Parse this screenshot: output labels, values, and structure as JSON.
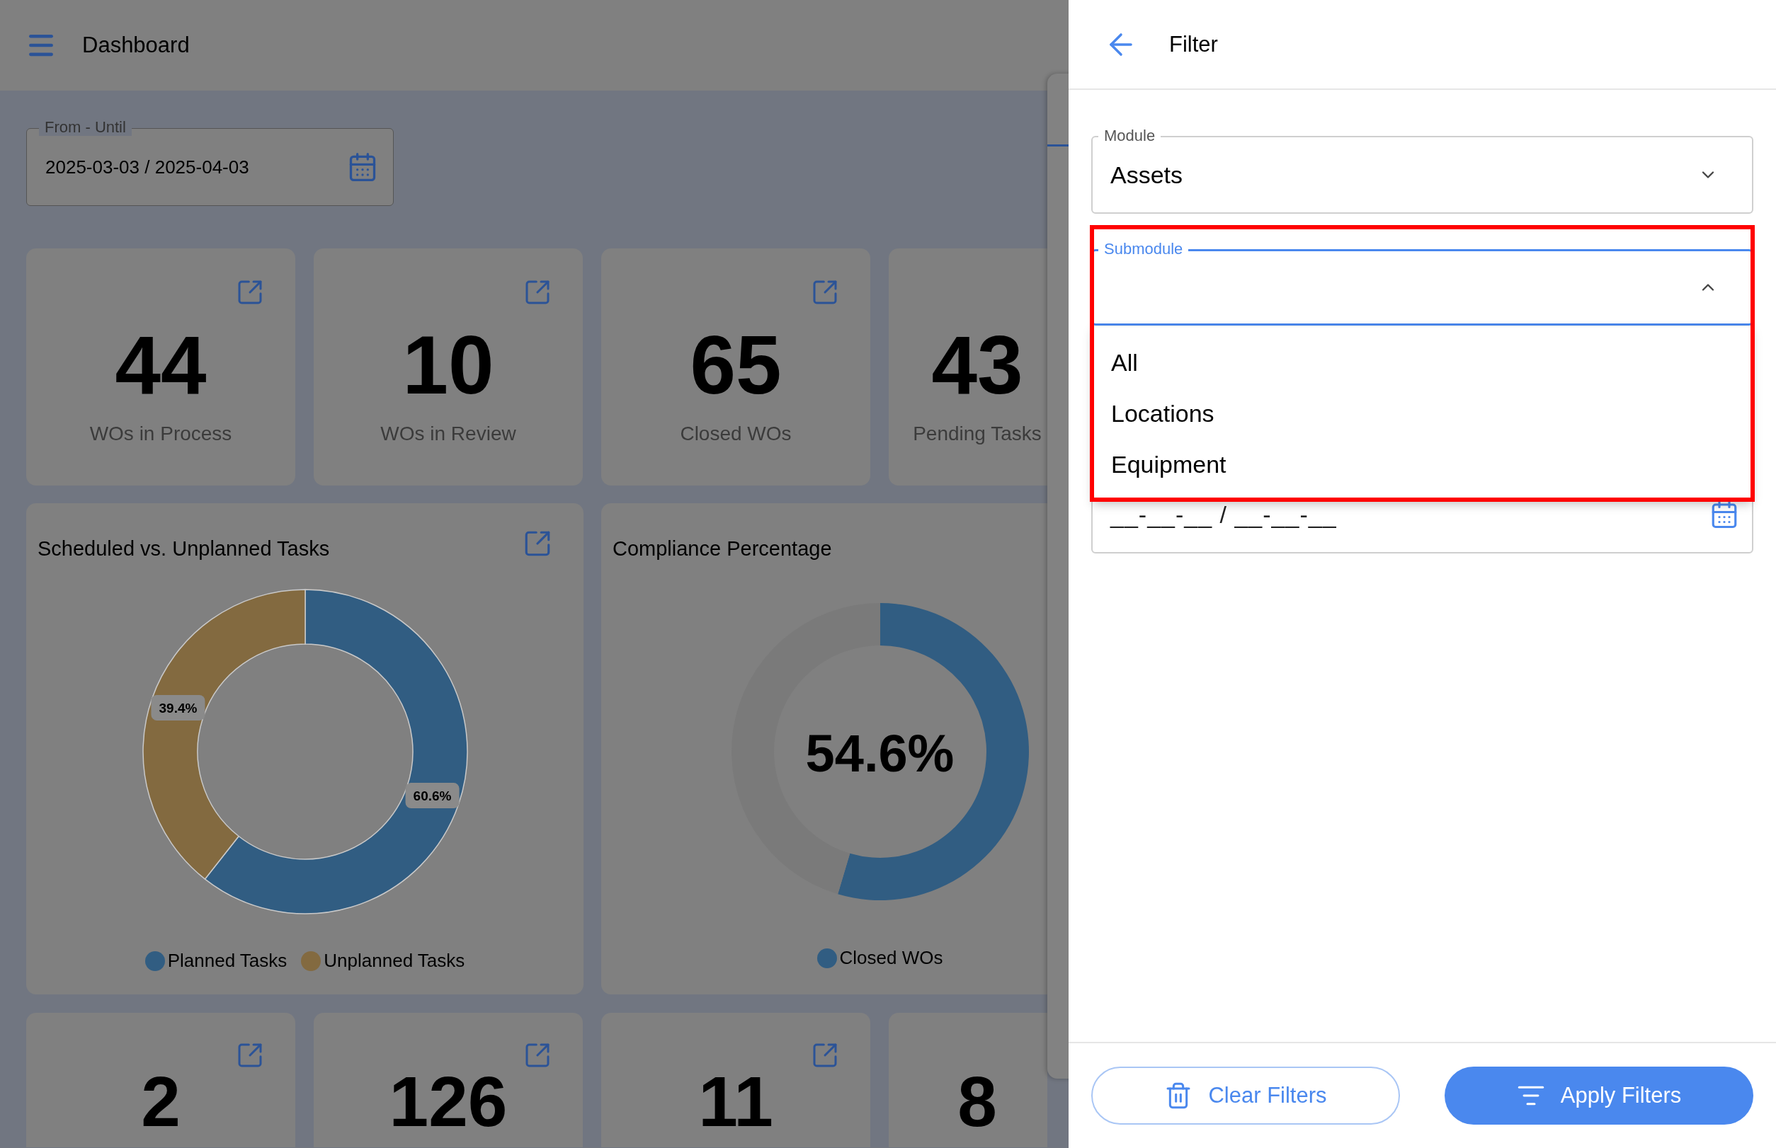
{
  "header": {
    "title": "Dashboard"
  },
  "date_range": {
    "label": "From - Until",
    "value": "2025-03-03 / 2025-04-03"
  },
  "stat_cards": [
    {
      "value": "44",
      "label": "WOs in Process"
    },
    {
      "value": "10",
      "label": "WOs in Review"
    },
    {
      "value": "65",
      "label": "Closed WOs"
    },
    {
      "value": "43",
      "label": "Pending Tasks"
    }
  ],
  "charts": [
    {
      "title": "Scheduled vs. Unplanned Tasks",
      "chart_data": {
        "type": "donut",
        "categories": [
          "Planned Tasks",
          "Unplanned Tasks"
        ],
        "values": [
          60.6,
          39.4
        ],
        "value_labels": [
          "60.6%",
          "39.4%"
        ]
      }
    },
    {
      "title": "Compliance Percentage",
      "center_label": "54.6%",
      "chart_data": {
        "type": "donut",
        "categories": [
          "Closed WOs",
          null
        ],
        "values": [
          54.6,
          45.4
        ]
      }
    }
  ],
  "bottom_cards": [
    {
      "value": "2"
    },
    {
      "value": "126"
    },
    {
      "value": "11"
    },
    {
      "value": "8"
    }
  ],
  "filter": {
    "title": "Filter",
    "fields": [
      {
        "kind": "select",
        "label": "Module",
        "value": "Assets",
        "expanded": false,
        "focused": false,
        "highlighted": false
      },
      {
        "kind": "select",
        "label": "Submodule",
        "expanded": true,
        "focused": true,
        "highlighted": true,
        "options": [
          {
            "label": "All",
            "selected": false
          },
          {
            "label": "Locations",
            "selected": false
          },
          {
            "label": "Equipment",
            "selected": false
          }
        ]
      },
      {
        "kind": "date",
        "placeholder": "__-__-__ / __-__-__"
      }
    ],
    "buttons": [
      {
        "kind": "outline",
        "label": "Clear Filters"
      },
      {
        "kind": "primary",
        "label": "Apply Filters"
      }
    ]
  }
}
